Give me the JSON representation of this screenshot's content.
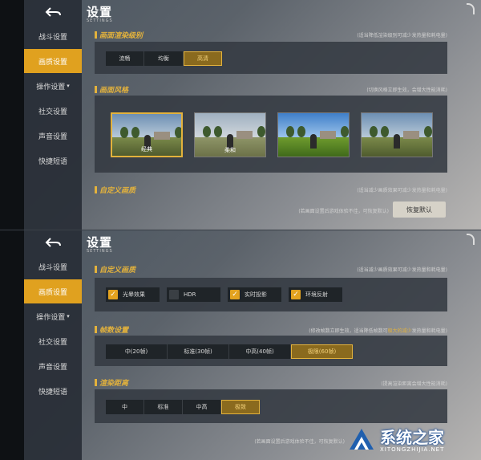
{
  "screens": [
    {
      "header": {
        "title": "设置",
        "subtitle": "SETTINGS"
      },
      "sidebar": {
        "items": [
          {
            "label": "战斗设置",
            "active": false
          },
          {
            "label": "画质设置",
            "active": true
          },
          {
            "label": "操作设置",
            "active": false,
            "arrow": "▾"
          },
          {
            "label": "社交设置",
            "active": false
          },
          {
            "label": "声音设置",
            "active": false
          },
          {
            "label": "快捷短语",
            "active": false
          }
        ]
      },
      "sections": {
        "render_level": {
          "title": "画面渲染级别",
          "note": "(适当降低渲染级别可减少发热量和耗电量)",
          "options": [
            "流畅",
            "均衡",
            "高清"
          ],
          "selected": "高清"
        },
        "style": {
          "title": "画面风格",
          "note": "(切换风格立即生效，会增大性能消耗)",
          "thumbs": [
            "经典",
            "柔和",
            "",
            ""
          ],
          "selected_index": 0
        },
        "custom": {
          "title": "自定义画质",
          "note": "(适当减少画质效果可减少发热量和耗电量)"
        }
      },
      "footer": {
        "hint": "(若画面设置后游戏体验不佳，可恢复默认)",
        "reset_button": "恢复默认"
      }
    },
    {
      "header": {
        "title": "设置",
        "subtitle": "SETTINGS"
      },
      "sidebar": {
        "items": [
          {
            "label": "战斗设置",
            "active": false
          },
          {
            "label": "画质设置",
            "active": true
          },
          {
            "label": "操作设置",
            "active": false,
            "arrow": "▾"
          },
          {
            "label": "社交设置",
            "active": false
          },
          {
            "label": "声音设置",
            "active": false
          },
          {
            "label": "快捷短语",
            "active": false
          }
        ]
      },
      "sections": {
        "custom": {
          "title": "自定义画质",
          "note": "(适当减少画质效果可减少发热量和耗电量)",
          "checks": [
            {
              "label": "光晕效果",
              "checked": true
            },
            {
              "label": "HDR",
              "checked": false
            },
            {
              "label": "实时投影",
              "checked": true
            },
            {
              "label": "环境反射",
              "checked": true
            }
          ]
        },
        "fps": {
          "title": "帧数设置",
          "note_pre": "(修改帧数立即生效，适当降低帧数可",
          "note_hl": "极大的减少",
          "note_post": "发热量和耗电量)",
          "options": [
            "中(20帧)",
            "标准(30帧)",
            "中高(40帧)",
            "极限(60帧)"
          ],
          "selected": "极限(60帧)"
        },
        "distance": {
          "title": "渲染距离",
          "note": "(提高渲染距离会增大性能消耗)",
          "options": [
            "中",
            "标准",
            "中高",
            "极致"
          ],
          "selected": "极致"
        }
      },
      "footer": {
        "hint": "(若画面设置后游戏体验不佳，可恢复默认)"
      }
    }
  ],
  "watermark": {
    "text": "系统之家",
    "url_text": "XITONGZHIJIA.NET"
  },
  "colors": {
    "accent": "#e3b23c",
    "active_nav": "#e0a11f",
    "panel": "#343a42"
  },
  "icons": [
    "back-arrow-icon",
    "checkmark-icon",
    "corner-hook-icon"
  ]
}
